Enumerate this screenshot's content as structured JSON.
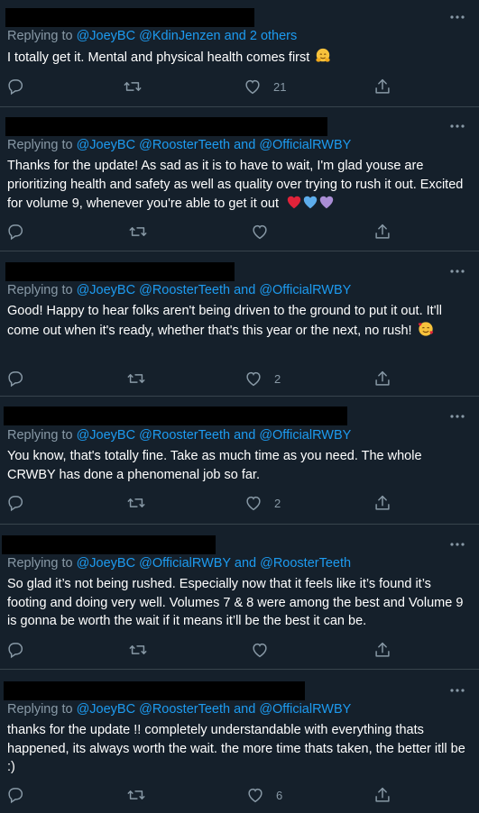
{
  "tweets": [
    {
      "replying_prefix": "Replying to ",
      "mentions": "@JoeyBC @KdinJenzen",
      "connector": " and ",
      "others": "2 others",
      "text": "I totally get it. Mental and physical health comes first",
      "emoji": "hugging-face",
      "likes": "21"
    },
    {
      "replying_prefix": "Replying to ",
      "mentions": "@JoeyBC @RoosterTeeth",
      "connector": " and ",
      "others": "@OfficialRWBY",
      "text": "Thanks for the update! As sad as it is to have to wait, I'm glad youse are prioritizing health and safety as well as quality over trying to rush it out. Excited for volume 9, whenever you're able to get it out",
      "emoji": "red-blue-purple-hearts",
      "likes": ""
    },
    {
      "replying_prefix": "Replying to ",
      "mentions": "@JoeyBC @RoosterTeeth",
      "connector": " and ",
      "others": "@OfficialRWBY",
      "text": "Good! Happy to hear folks aren't being driven to the ground to put it out. It'll come out when it's ready, whether that's this year or the next, no rush!",
      "emoji": "smiling-face-with-hearts",
      "likes": "2"
    },
    {
      "replying_prefix": "Replying to ",
      "mentions": "@JoeyBC @RoosterTeeth",
      "connector": " and ",
      "others": "@OfficialRWBY",
      "text": "You know, that's totally fine. Take as much time as you need. The whole CRWBY has done a phenomenal job so far.",
      "likes": "2"
    },
    {
      "replying_prefix": "Replying to ",
      "mentions": "@JoeyBC @OfficialRWBY",
      "connector": " and ",
      "others": "@RoosterTeeth",
      "text": "So glad it’s not being rushed. Especially now that it feels like it’s found it’s footing and doing very well. Volumes 7 & 8 were among the best and Volume 9 is gonna be worth the wait if it means it’ll be the best it can be.",
      "likes": ""
    },
    {
      "replying_prefix": "Replying to ",
      "mentions": "@JoeyBC @RoosterTeeth",
      "connector": " and ",
      "others": "@OfficialRWBY",
      "text": "thanks for the update !! completely understandable with everything thats happened, its always worth the wait. the more time thats taken, the better itll be :)",
      "likes": "6"
    }
  ],
  "icons": [
    "more-icon",
    "reply-icon",
    "retweet-icon",
    "like-icon",
    "share-icon"
  ],
  "colors": {
    "background": "#15202b",
    "link": "#1d9bf0",
    "muted": "#8899a6",
    "divider": "#38444d"
  }
}
